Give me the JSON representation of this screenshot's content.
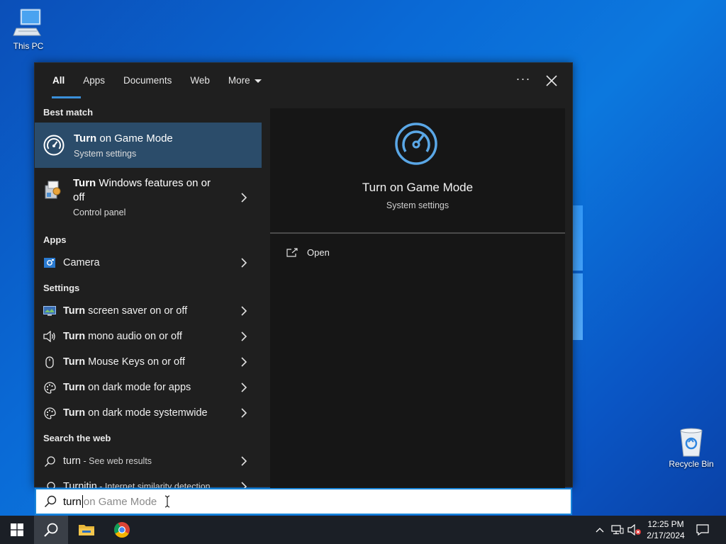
{
  "desktop": {
    "this_pc_label": "This PC",
    "recycle_bin_label": "Recycle Bin"
  },
  "tabs": [
    {
      "label": "All",
      "active": true
    },
    {
      "label": "Apps"
    },
    {
      "label": "Documents"
    },
    {
      "label": "Web"
    },
    {
      "label": "More"
    }
  ],
  "panel": {
    "more_options": "···",
    "sections": {
      "best_match": "Best match",
      "apps": "Apps",
      "settings": "Settings",
      "search_web": "Search the web"
    },
    "best_match": {
      "bold": "Turn",
      "rest": " on Game Mode",
      "sub": "System settings"
    },
    "windows_features": {
      "bold": "Turn",
      "rest_line1": " Windows features on or",
      "rest_line2": "off",
      "sub": "Control panel"
    },
    "apps": [
      {
        "label": "Camera",
        "icon": "camera-icon"
      }
    ],
    "settings": [
      {
        "bold": "Turn",
        "rest": " screen saver on or off",
        "icon": "monitor-icon"
      },
      {
        "bold": "Turn",
        "rest": " mono audio on or off",
        "icon": "speaker-icon"
      },
      {
        "bold": "Turn",
        "rest": " Mouse Keys on or off",
        "icon": "mouse-icon"
      },
      {
        "bold": "Turn",
        "rest": " on dark mode for apps",
        "icon": "palette-icon"
      },
      {
        "bold": "Turn",
        "rest": " on dark mode systemwide",
        "icon": "palette-icon"
      }
    ],
    "web": [
      {
        "bold": "turn",
        "rest": " - See web results"
      },
      {
        "bold": "Turnitin",
        "rest": " - Internet similarity detection"
      }
    ]
  },
  "preview": {
    "title": "Turn on Game Mode",
    "subtitle": "System settings",
    "open_label": "Open"
  },
  "search": {
    "typed": "turn",
    "hint": " on Game Mode"
  },
  "taskbar": {
    "time": "12:25 PM",
    "date": "2/17/2024"
  },
  "colors": {
    "accent": "#3a8fd9",
    "best_match_bg": "#2b4c6a",
    "game_icon": "#5aa7e6"
  }
}
